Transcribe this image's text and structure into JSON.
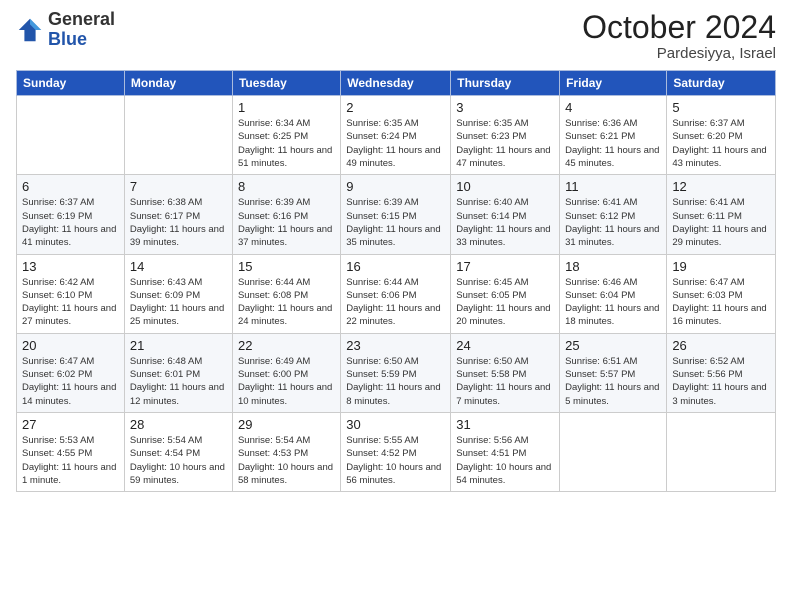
{
  "header": {
    "logo_general": "General",
    "logo_blue": "Blue",
    "month": "October 2024",
    "location": "Pardesiyya, Israel"
  },
  "weekdays": [
    "Sunday",
    "Monday",
    "Tuesday",
    "Wednesday",
    "Thursday",
    "Friday",
    "Saturday"
  ],
  "weeks": [
    [
      {
        "day": "",
        "info": ""
      },
      {
        "day": "",
        "info": ""
      },
      {
        "day": "1",
        "info": "Sunrise: 6:34 AM\nSunset: 6:25 PM\nDaylight: 11 hours and 51 minutes."
      },
      {
        "day": "2",
        "info": "Sunrise: 6:35 AM\nSunset: 6:24 PM\nDaylight: 11 hours and 49 minutes."
      },
      {
        "day": "3",
        "info": "Sunrise: 6:35 AM\nSunset: 6:23 PM\nDaylight: 11 hours and 47 minutes."
      },
      {
        "day": "4",
        "info": "Sunrise: 6:36 AM\nSunset: 6:21 PM\nDaylight: 11 hours and 45 minutes."
      },
      {
        "day": "5",
        "info": "Sunrise: 6:37 AM\nSunset: 6:20 PM\nDaylight: 11 hours and 43 minutes."
      }
    ],
    [
      {
        "day": "6",
        "info": "Sunrise: 6:37 AM\nSunset: 6:19 PM\nDaylight: 11 hours and 41 minutes."
      },
      {
        "day": "7",
        "info": "Sunrise: 6:38 AM\nSunset: 6:17 PM\nDaylight: 11 hours and 39 minutes."
      },
      {
        "day": "8",
        "info": "Sunrise: 6:39 AM\nSunset: 6:16 PM\nDaylight: 11 hours and 37 minutes."
      },
      {
        "day": "9",
        "info": "Sunrise: 6:39 AM\nSunset: 6:15 PM\nDaylight: 11 hours and 35 minutes."
      },
      {
        "day": "10",
        "info": "Sunrise: 6:40 AM\nSunset: 6:14 PM\nDaylight: 11 hours and 33 minutes."
      },
      {
        "day": "11",
        "info": "Sunrise: 6:41 AM\nSunset: 6:12 PM\nDaylight: 11 hours and 31 minutes."
      },
      {
        "day": "12",
        "info": "Sunrise: 6:41 AM\nSunset: 6:11 PM\nDaylight: 11 hours and 29 minutes."
      }
    ],
    [
      {
        "day": "13",
        "info": "Sunrise: 6:42 AM\nSunset: 6:10 PM\nDaylight: 11 hours and 27 minutes."
      },
      {
        "day": "14",
        "info": "Sunrise: 6:43 AM\nSunset: 6:09 PM\nDaylight: 11 hours and 25 minutes."
      },
      {
        "day": "15",
        "info": "Sunrise: 6:44 AM\nSunset: 6:08 PM\nDaylight: 11 hours and 24 minutes."
      },
      {
        "day": "16",
        "info": "Sunrise: 6:44 AM\nSunset: 6:06 PM\nDaylight: 11 hours and 22 minutes."
      },
      {
        "day": "17",
        "info": "Sunrise: 6:45 AM\nSunset: 6:05 PM\nDaylight: 11 hours and 20 minutes."
      },
      {
        "day": "18",
        "info": "Sunrise: 6:46 AM\nSunset: 6:04 PM\nDaylight: 11 hours and 18 minutes."
      },
      {
        "day": "19",
        "info": "Sunrise: 6:47 AM\nSunset: 6:03 PM\nDaylight: 11 hours and 16 minutes."
      }
    ],
    [
      {
        "day": "20",
        "info": "Sunrise: 6:47 AM\nSunset: 6:02 PM\nDaylight: 11 hours and 14 minutes."
      },
      {
        "day": "21",
        "info": "Sunrise: 6:48 AM\nSunset: 6:01 PM\nDaylight: 11 hours and 12 minutes."
      },
      {
        "day": "22",
        "info": "Sunrise: 6:49 AM\nSunset: 6:00 PM\nDaylight: 11 hours and 10 minutes."
      },
      {
        "day": "23",
        "info": "Sunrise: 6:50 AM\nSunset: 5:59 PM\nDaylight: 11 hours and 8 minutes."
      },
      {
        "day": "24",
        "info": "Sunrise: 6:50 AM\nSunset: 5:58 PM\nDaylight: 11 hours and 7 minutes."
      },
      {
        "day": "25",
        "info": "Sunrise: 6:51 AM\nSunset: 5:57 PM\nDaylight: 11 hours and 5 minutes."
      },
      {
        "day": "26",
        "info": "Sunrise: 6:52 AM\nSunset: 5:56 PM\nDaylight: 11 hours and 3 minutes."
      }
    ],
    [
      {
        "day": "27",
        "info": "Sunrise: 5:53 AM\nSunset: 4:55 PM\nDaylight: 11 hours and 1 minute."
      },
      {
        "day": "28",
        "info": "Sunrise: 5:54 AM\nSunset: 4:54 PM\nDaylight: 10 hours and 59 minutes."
      },
      {
        "day": "29",
        "info": "Sunrise: 5:54 AM\nSunset: 4:53 PM\nDaylight: 10 hours and 58 minutes."
      },
      {
        "day": "30",
        "info": "Sunrise: 5:55 AM\nSunset: 4:52 PM\nDaylight: 10 hours and 56 minutes."
      },
      {
        "day": "31",
        "info": "Sunrise: 5:56 AM\nSunset: 4:51 PM\nDaylight: 10 hours and 54 minutes."
      },
      {
        "day": "",
        "info": ""
      },
      {
        "day": "",
        "info": ""
      }
    ]
  ]
}
